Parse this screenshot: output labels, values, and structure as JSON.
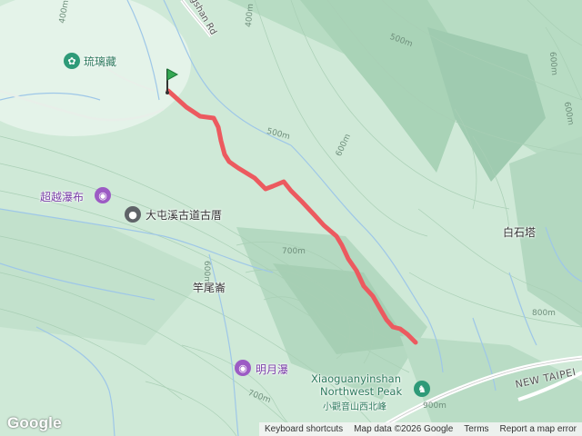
{
  "map": {
    "places": {
      "liulicang": "琉璃藏",
      "chaoyue_waterfall": "超越瀑布",
      "datunxi_trail": "大屯溪古道古厝",
      "ganweilun": "竿尾崙",
      "baishita": "白石塔",
      "mingyue_waterfall": "明月瀑",
      "xiaoguanyin_en_1": "Xiaoguanyinshan",
      "xiaoguanyin_en_2": "Northwest Peak",
      "xiaoguanyin_zh": "小觀音山西北峰"
    },
    "roads": {
      "top_road": "gshan Rd",
      "new_taipei": "NEW TAIPEI"
    },
    "contours": [
      "400m",
      "400m",
      "500m",
      "500m",
      "600m",
      "600m",
      "600m",
      "700m",
      "800m",
      "700m",
      "900m",
      "600m"
    ],
    "icons": {
      "start_marker": "start-flag-icon",
      "liulicang": "flower-icon",
      "waterfall": "camera-icon",
      "trail": "pin-icon",
      "peak": "hiking-icon"
    },
    "colors": {
      "track": "#ec5a5f",
      "terrain": "#cfe9d7",
      "stream": "#9ec7e8",
      "poi_green": "#2e9a78",
      "poi_purple": "#9c5bc4",
      "poi_gray": "#5f6368"
    }
  },
  "footer": {
    "logo": "Google",
    "keyboard": "Keyboard shortcuts",
    "mapdata": "Map data ©2026 Google",
    "terms": "Terms",
    "report": "Report a map error"
  }
}
